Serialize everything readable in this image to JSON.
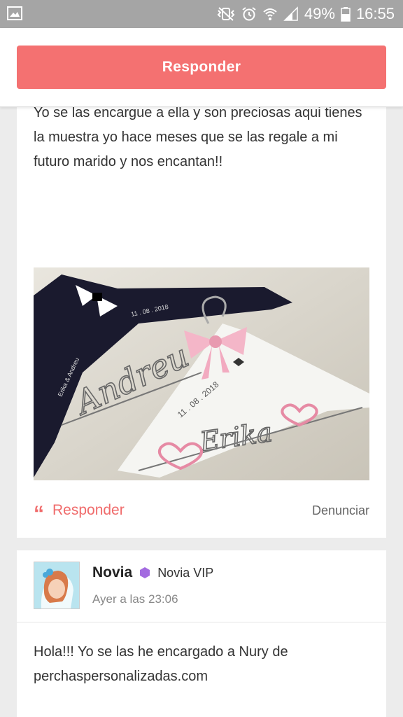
{
  "status_bar": {
    "battery": "49%",
    "time": "16:55"
  },
  "header": {
    "reply_label": "Responder"
  },
  "post1": {
    "text": "Yo se las encargue a ella y son preciosas aqui tienes la muestra yo hace meses que se las regale a mi futuro marido y nos encantan!!",
    "photo": {
      "name1": "Andreu",
      "name2": "Erika",
      "date": "11 . 08 . 2018",
      "small_name_black": "Erika & Andreu",
      "small_date_black": "11 . 08 . 2018"
    },
    "reply_label": "Responder",
    "report_label": "Denunciar"
  },
  "post2": {
    "author": "Novia",
    "badge": "Novia VIP",
    "timestamp": "Ayer a las 23:06",
    "text": "Hola!!! Yo se las he encargado a Nury de perchaspersonalizadas.com"
  },
  "colors": {
    "accent": "#f47171",
    "vip": "#a36be0"
  }
}
